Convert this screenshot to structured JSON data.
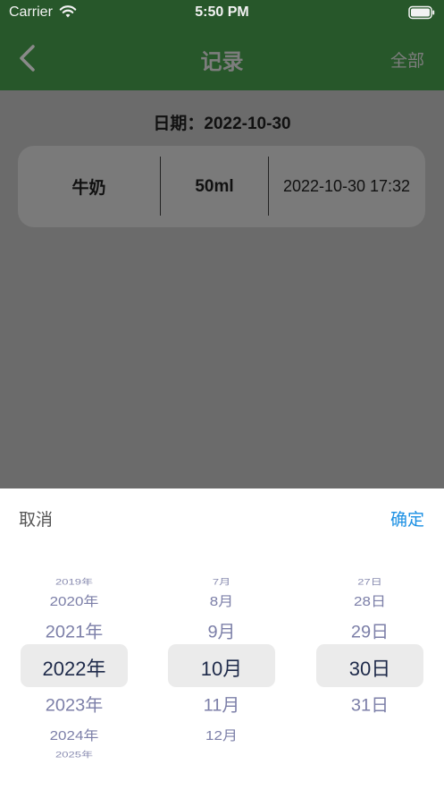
{
  "status_bar": {
    "carrier": "Carrier",
    "time": "5:50 PM"
  },
  "nav": {
    "title": "记录",
    "right_label": "全部"
  },
  "date_line": "日期：2022-10-30",
  "record": {
    "name": "牛奶",
    "amount": "50ml",
    "datetime": "2022-10-30 17:32"
  },
  "picker": {
    "cancel_label": "取消",
    "confirm_label": "确定",
    "year": {
      "above": [
        "2019年",
        "2020年",
        "2021年"
      ],
      "selected": "2022年",
      "below": [
        "2023年",
        "2024年",
        "2025年"
      ]
    },
    "month": {
      "above": [
        "7月",
        "8月",
        "9月"
      ],
      "selected": "10月",
      "below": [
        "11月",
        "12月"
      ]
    },
    "day": {
      "above": [
        "27日",
        "28日",
        "29日"
      ],
      "selected": "30日",
      "below": [
        "31日"
      ]
    }
  },
  "colors": {
    "nav_bg": "#27572a",
    "overlay": "#6b6b6b",
    "confirm": "#1a8fe3",
    "picker_text": "#7c7fa8"
  }
}
